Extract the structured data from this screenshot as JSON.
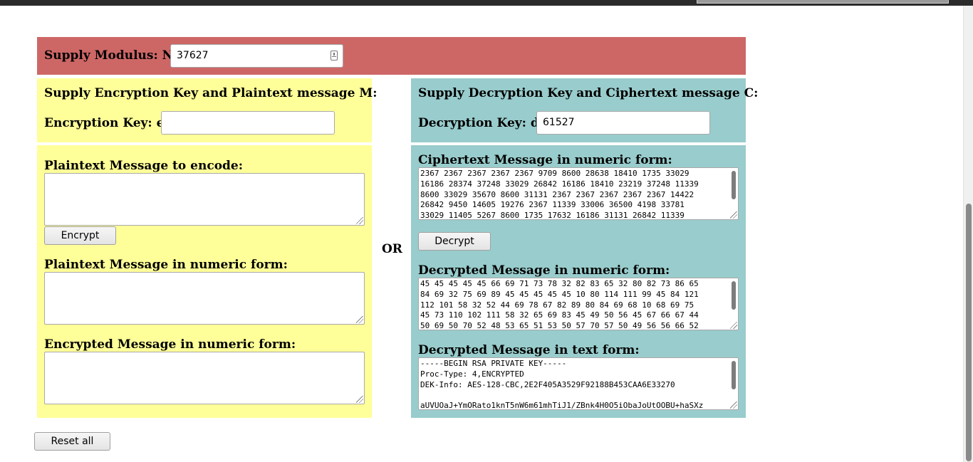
{
  "modulus": {
    "label": "Supply Modulus: N",
    "value": "37627"
  },
  "encrypt": {
    "heading": "Supply Encryption Key and Plaintext message M:",
    "key_label": "Encryption Key: e",
    "key_value": "",
    "plaintext_label": "Plaintext Message to encode:",
    "plaintext_value": "",
    "button_label": "Encrypt",
    "numeric_label": "Plaintext Message in numeric form:",
    "numeric_value": "",
    "encrypted_label": "Encrypted Message in numeric form:",
    "encrypted_value": ""
  },
  "or_label": "OR",
  "decrypt": {
    "heading": "Supply Decryption Key and Ciphertext message C:",
    "key_label": "Decryption Key: d",
    "key_value": "61527",
    "cipher_label": "Ciphertext Message in numeric form:",
    "cipher_value": "2367 2367 2367 2367 2367 9709 8600 28638 18410 1735 33029\n16186 28374 37248 33029 26842 16186 18410 23219 37248 11339\n8600 33029 35670 8600 31131 2367 2367 2367 2367 2367 14422\n26842 9450 14605 19276 2367 11339 33006 36500 4198 33781\n33029 11405 5267 8600 1735 17632 16186 31131 26842 11339",
    "button_label": "Decrypt",
    "numeric_label": "Decrypted Message in numeric form:",
    "numeric_value": "45 45 45 45 45 66 69 71 73 78 32 82 83 65 32 80 82 73 86 65\n84 69 32 75 69 89 45 45 45 45 45 10 80 114 111 99 45 84 121\n112 101 58 32 52 44 69 78 67 82 89 80 84 69 68 10 68 69 75\n45 73 110 102 111 58 32 65 69 83 45 49 50 56 45 67 66 67 44\n50 69 50 70 52 48 53 65 51 53 50 57 70 57 50 49 56 56 66 52",
    "text_label": "Decrypted Message in text form:",
    "text_value": "-----BEGIN RSA PRIVATE KEY-----\nProc-Type: 4,ENCRYPTED\nDEK-Info: AES-128-CBC,2E2F405A3529F92188B453CAA6E33270\n\naUVUOaJ+YmORato1knT5nW6m61mhTiJ1/ZBnk4H0O5iObaJoUtOOBU+haSXz"
  },
  "reset_label": "Reset all",
  "colors": {
    "red": "#cd6766",
    "yellow": "#ffff99",
    "teal": "#99cccc"
  }
}
